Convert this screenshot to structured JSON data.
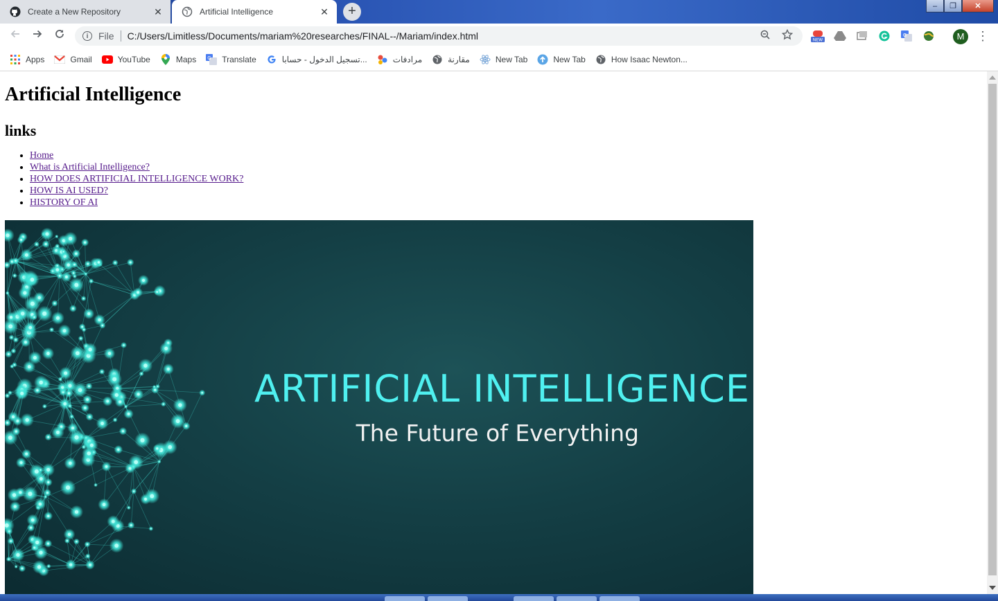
{
  "browser": {
    "tabs": [
      {
        "title": "Create a New Repository",
        "icon": "github-icon",
        "active": false
      },
      {
        "title": "Artificial Intelligence",
        "icon": "globe-icon",
        "active": true
      }
    ],
    "close_glyph": "✕",
    "new_tab_glyph": "+",
    "window_controls": {
      "minimize": "–",
      "maximize": "❐",
      "close": "✕"
    },
    "address_bar": {
      "scheme": "File",
      "url": "C:/Users/Limitless/Documents/mariam%20researches/FINAL--/Mariam/index.html"
    },
    "profile_initial": "M",
    "bookmarks": [
      {
        "label": "Apps",
        "icon": "apps-grid-icon"
      },
      {
        "label": "Gmail",
        "icon": "gmail-icon"
      },
      {
        "label": "YouTube",
        "icon": "youtube-icon"
      },
      {
        "label": "Maps",
        "icon": "maps-pin-icon"
      },
      {
        "label": "Translate",
        "icon": "translate-icon"
      },
      {
        "label": "تسجيل الدخول - حسابا...",
        "icon": "google-icon"
      },
      {
        "label": "مرادفات",
        "icon": "bubbles-icon"
      },
      {
        "label": "مقارنة",
        "icon": "globe-icon"
      },
      {
        "label": "New Tab",
        "icon": "atom-icon"
      },
      {
        "label": "New Tab",
        "icon": "upload-icon"
      },
      {
        "label": "How Isaac Newton...",
        "icon": "globe-icon"
      }
    ]
  },
  "page": {
    "title": "Artificial Intelligence",
    "links_heading": "links",
    "links": [
      {
        "label": "Home",
        "visited": true
      },
      {
        "label": "What is Artificial Intelligence?",
        "visited": true
      },
      {
        "label": "HOW DOES ARTIFICIAL INTELLIGENCE WORK?",
        "visited": true
      },
      {
        "label": "HOW IS AI USED?",
        "visited": true
      },
      {
        "label": "HISTORY OF AI",
        "visited": true
      }
    ],
    "hero": {
      "heading": "ARTIFICIAL INTELLIGENCE",
      "subheading": "The Future of Everything"
    }
  },
  "colors": {
    "hero_text": "#4ff0f0",
    "hero_bg": "#143f45",
    "link_visited": "#551a8b"
  }
}
